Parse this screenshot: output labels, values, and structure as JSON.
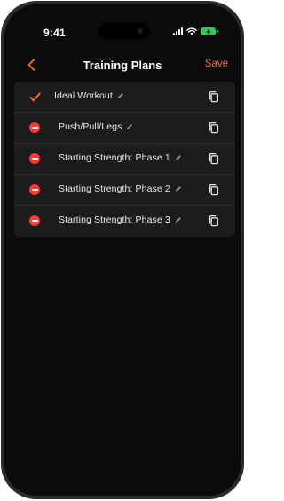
{
  "status_bar": {
    "time": "9:41",
    "battery_color": "#34c759"
  },
  "nav": {
    "back_icon": "chevron-left-icon",
    "title": "Training Plans",
    "save_label": "Save",
    "accent_color": "#ff6b2e"
  },
  "plans": [
    {
      "name": "Ideal Workout",
      "lead_icon": "checkmark-icon",
      "selected": true
    },
    {
      "name": "Push/Pull/Legs",
      "lead_icon": "delete-minus-icon",
      "selected": false
    },
    {
      "name": "Starting Strength: Phase 1",
      "lead_icon": "delete-minus-icon",
      "selected": false
    },
    {
      "name": "Starting Strength: Phase 2",
      "lead_icon": "delete-minus-icon",
      "selected": false
    },
    {
      "name": "Starting Strength: Phase 3",
      "lead_icon": "delete-minus-icon",
      "selected": false
    }
  ],
  "row_icons": {
    "edit": "pencil-icon",
    "copy": "copy-icon"
  },
  "delete_color": "#ff3b30"
}
